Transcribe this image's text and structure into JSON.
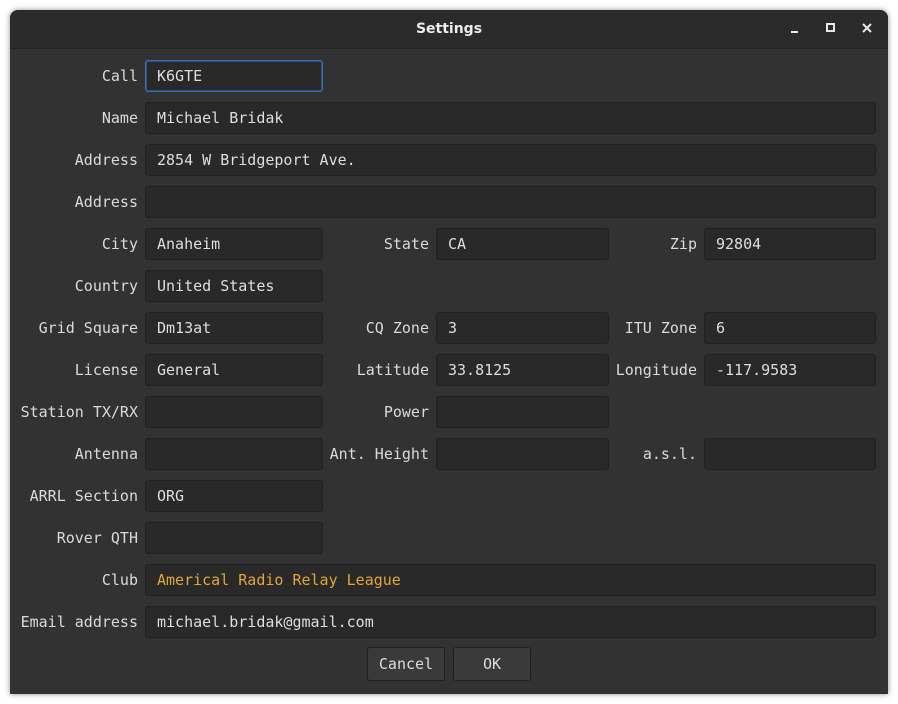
{
  "window": {
    "title": "Settings"
  },
  "form": {
    "call": {
      "label": "Call",
      "value": "K6GTE"
    },
    "name": {
      "label": "Name",
      "value": "Michael Bridak"
    },
    "address1": {
      "label": "Address",
      "value": "2854 W Bridgeport Ave."
    },
    "address2": {
      "label": "Address",
      "value": ""
    },
    "city": {
      "label": "City",
      "value": "Anaheim"
    },
    "state": {
      "label": "State",
      "value": "CA"
    },
    "zip": {
      "label": "Zip",
      "value": "92804"
    },
    "country": {
      "label": "Country",
      "value": "United States"
    },
    "grid_square": {
      "label": "Grid Square",
      "value": "Dm13at"
    },
    "cq_zone": {
      "label": "CQ Zone",
      "value": "3"
    },
    "itu_zone": {
      "label": "ITU Zone",
      "value": "6"
    },
    "license": {
      "label": "License",
      "value": "General"
    },
    "latitude": {
      "label": "Latitude",
      "value": "33.8125"
    },
    "longitude": {
      "label": "Longitude",
      "value": "-117.9583"
    },
    "station": {
      "label": "Station TX/RX",
      "value": ""
    },
    "power": {
      "label": "Power",
      "value": ""
    },
    "antenna": {
      "label": "Antenna",
      "value": ""
    },
    "ant_height": {
      "label": "Ant. Height",
      "value": ""
    },
    "asl": {
      "label": "a.s.l.",
      "value": ""
    },
    "arrl": {
      "label": "ARRL Section",
      "value": "ORG"
    },
    "rover": {
      "label": "Rover QTH",
      "value": ""
    },
    "club": {
      "label": "Club",
      "value": "Americal Radio Relay League"
    },
    "email": {
      "label": "Email address",
      "value": "michael.bridak@gmail.com"
    }
  },
  "buttons": {
    "cancel": "Cancel",
    "ok": "OK"
  },
  "colors": {
    "background": "#323232",
    "field": "#292929",
    "focus": "#3b6fa8",
    "club_text": "#e2a53a"
  }
}
